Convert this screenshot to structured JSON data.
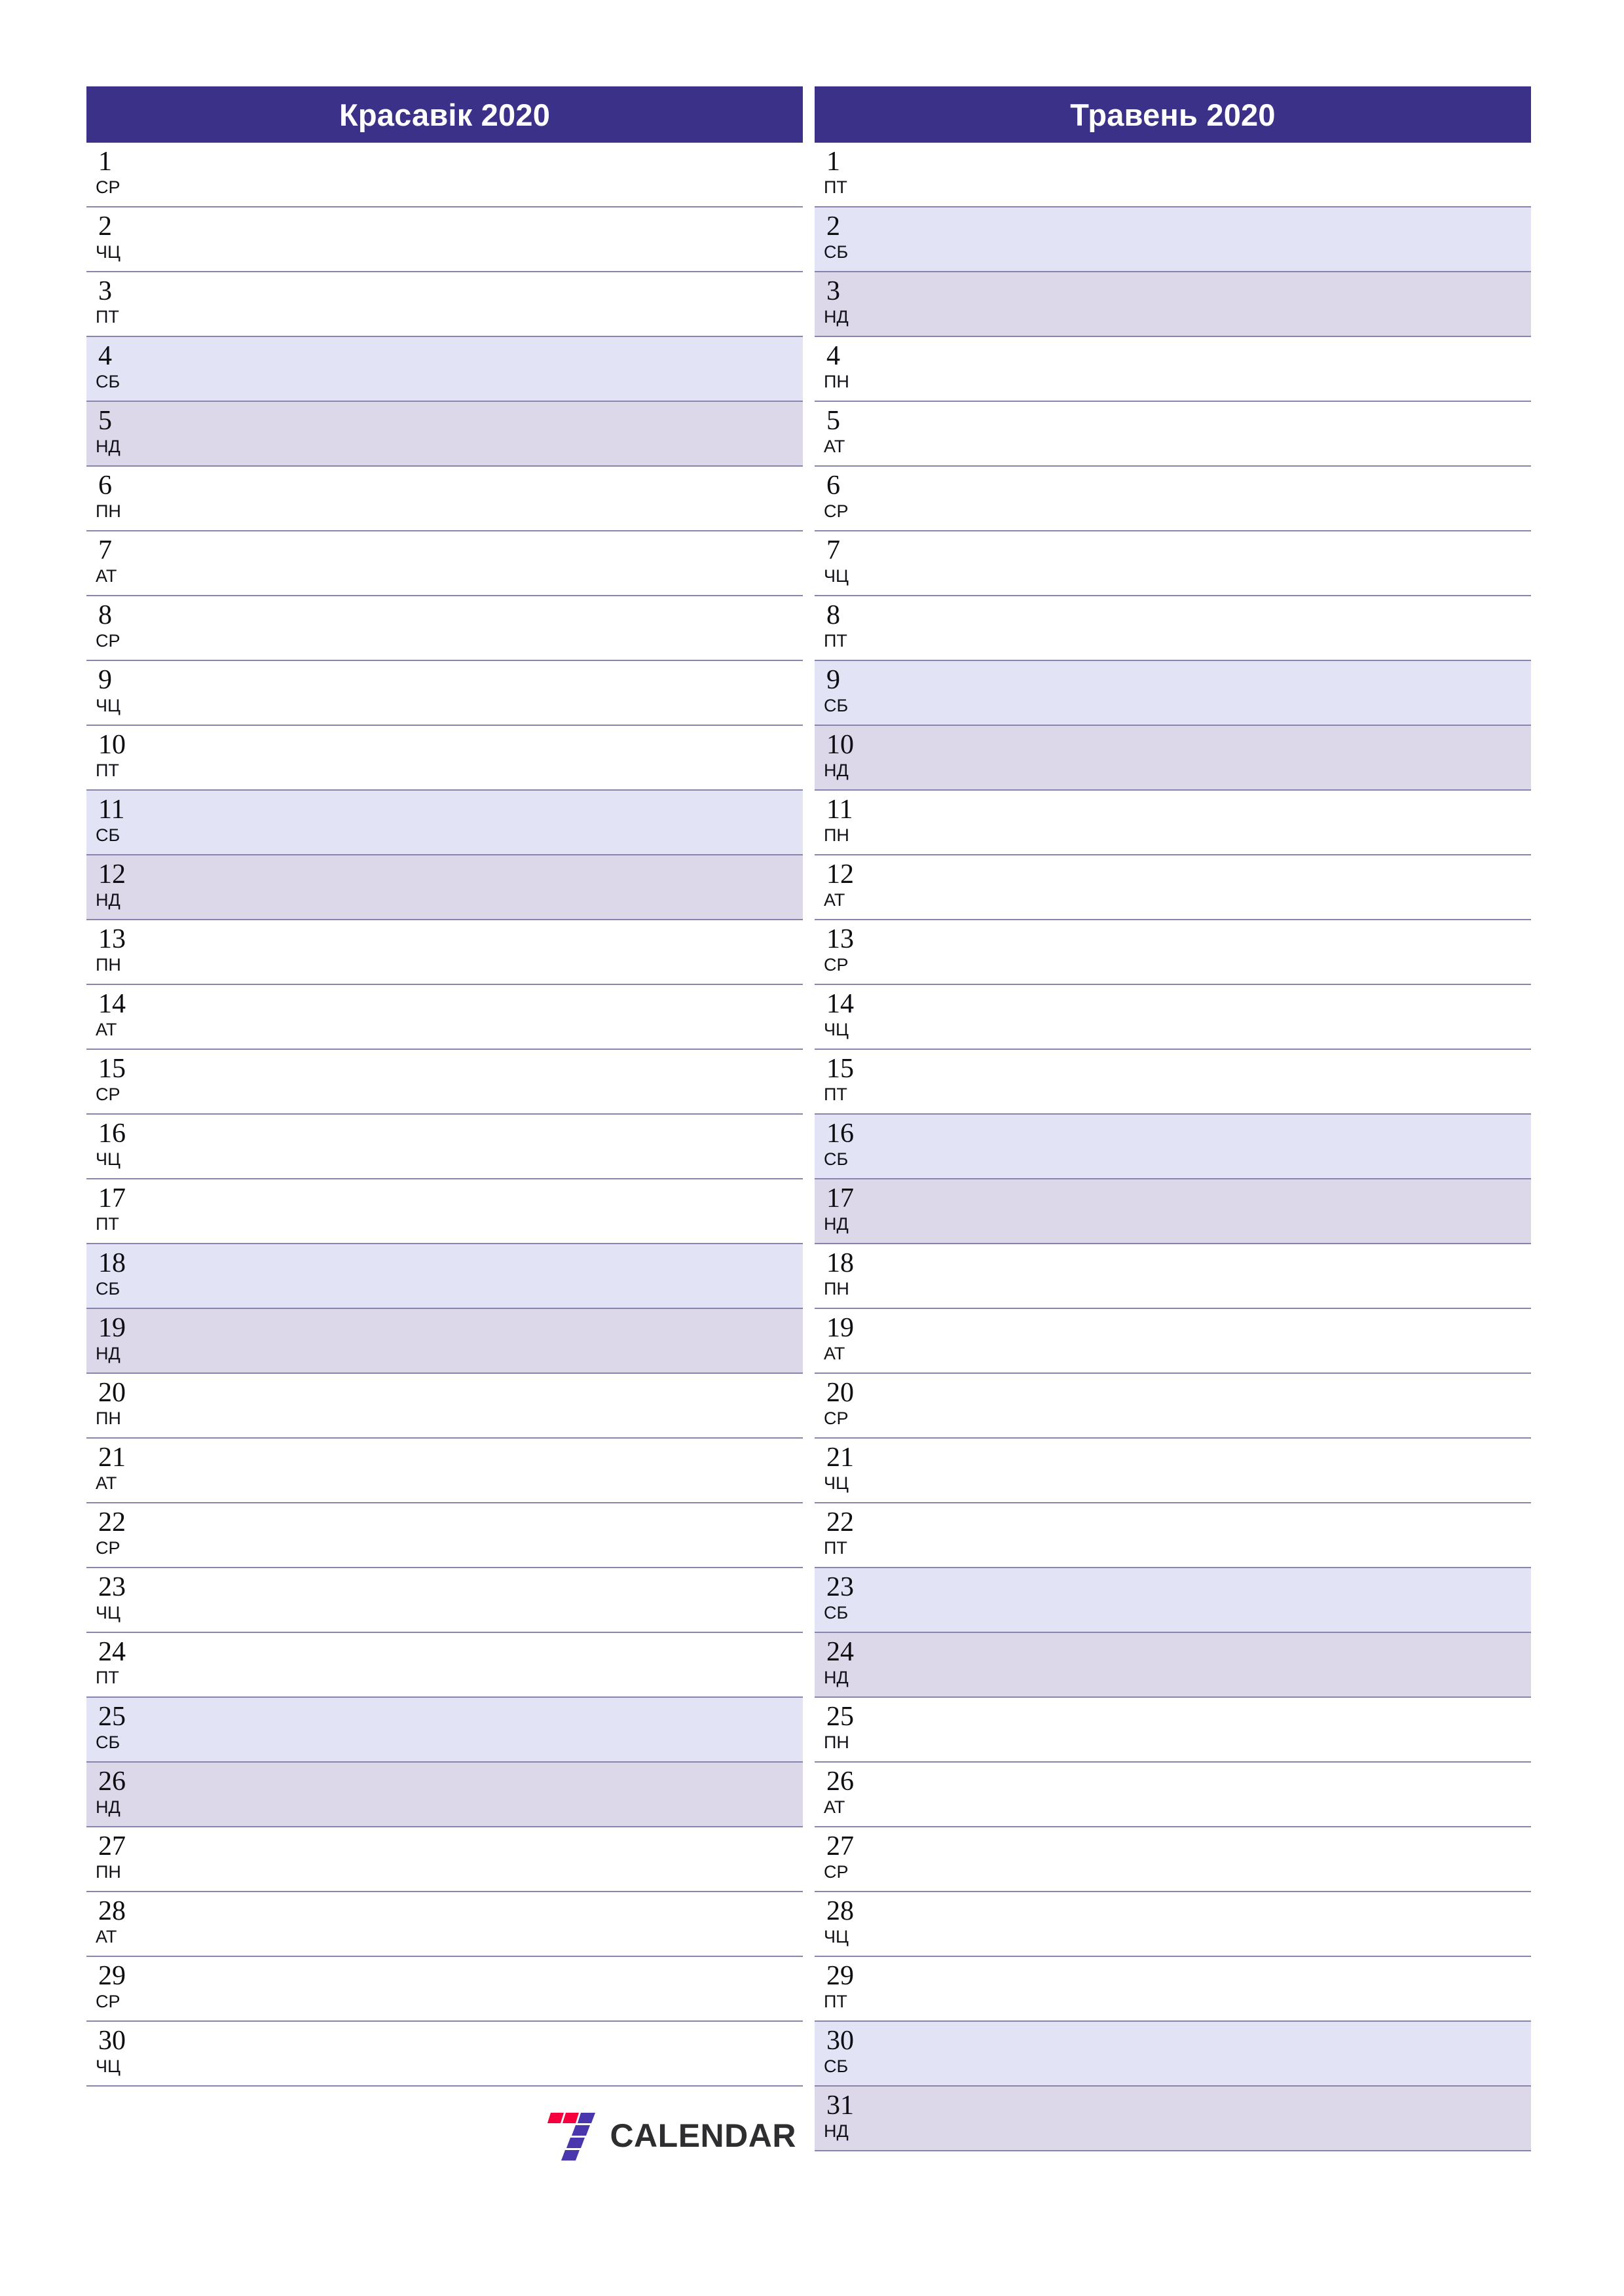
{
  "document": {
    "type": "two-month vertical planner",
    "year": "2020",
    "logo": {
      "mark_name": "seven-calendar-logo-mark",
      "wordmark": "CALENDAR",
      "colors": {
        "red": "#f5003c",
        "purple": "#4a36ad",
        "wordmark": "#2e2e30"
      }
    },
    "colors": {
      "header_background": "#3b3189",
      "header_text": "#ffffff",
      "saturday_row": "#e3e3f6",
      "sunday_row": "#dcd8ea",
      "row_border": "#8a83b0",
      "page_background": "#ffffff"
    }
  },
  "months": [
    {
      "title": "Красавік 2020",
      "days": [
        {
          "num": "1",
          "abbr": "СР",
          "kind": "weekday"
        },
        {
          "num": "2",
          "abbr": "ЧЦ",
          "kind": "weekday"
        },
        {
          "num": "3",
          "abbr": "ПТ",
          "kind": "weekday"
        },
        {
          "num": "4",
          "abbr": "СБ",
          "kind": "sat"
        },
        {
          "num": "5",
          "abbr": "НД",
          "kind": "sun"
        },
        {
          "num": "6",
          "abbr": "ПН",
          "kind": "weekday"
        },
        {
          "num": "7",
          "abbr": "АТ",
          "kind": "weekday"
        },
        {
          "num": "8",
          "abbr": "СР",
          "kind": "weekday"
        },
        {
          "num": "9",
          "abbr": "ЧЦ",
          "kind": "weekday"
        },
        {
          "num": "10",
          "abbr": "ПТ",
          "kind": "weekday"
        },
        {
          "num": "11",
          "abbr": "СБ",
          "kind": "sat"
        },
        {
          "num": "12",
          "abbr": "НД",
          "kind": "sun"
        },
        {
          "num": "13",
          "abbr": "ПН",
          "kind": "weekday"
        },
        {
          "num": "14",
          "abbr": "АТ",
          "kind": "weekday"
        },
        {
          "num": "15",
          "abbr": "СР",
          "kind": "weekday"
        },
        {
          "num": "16",
          "abbr": "ЧЦ",
          "kind": "weekday"
        },
        {
          "num": "17",
          "abbr": "ПТ",
          "kind": "weekday"
        },
        {
          "num": "18",
          "abbr": "СБ",
          "kind": "sat"
        },
        {
          "num": "19",
          "abbr": "НД",
          "kind": "sun"
        },
        {
          "num": "20",
          "abbr": "ПН",
          "kind": "weekday"
        },
        {
          "num": "21",
          "abbr": "АТ",
          "kind": "weekday"
        },
        {
          "num": "22",
          "abbr": "СР",
          "kind": "weekday"
        },
        {
          "num": "23",
          "abbr": "ЧЦ",
          "kind": "weekday"
        },
        {
          "num": "24",
          "abbr": "ПТ",
          "kind": "weekday"
        },
        {
          "num": "25",
          "abbr": "СБ",
          "kind": "sat"
        },
        {
          "num": "26",
          "abbr": "НД",
          "kind": "sun"
        },
        {
          "num": "27",
          "abbr": "ПН",
          "kind": "weekday"
        },
        {
          "num": "28",
          "abbr": "АТ",
          "kind": "weekday"
        },
        {
          "num": "29",
          "abbr": "СР",
          "kind": "weekday"
        },
        {
          "num": "30",
          "abbr": "ЧЦ",
          "kind": "weekday"
        }
      ]
    },
    {
      "title": "Травень 2020",
      "days": [
        {
          "num": "1",
          "abbr": "ПТ",
          "kind": "weekday"
        },
        {
          "num": "2",
          "abbr": "СБ",
          "kind": "sat"
        },
        {
          "num": "3",
          "abbr": "НД",
          "kind": "sun"
        },
        {
          "num": "4",
          "abbr": "ПН",
          "kind": "weekday"
        },
        {
          "num": "5",
          "abbr": "АТ",
          "kind": "weekday"
        },
        {
          "num": "6",
          "abbr": "СР",
          "kind": "weekday"
        },
        {
          "num": "7",
          "abbr": "ЧЦ",
          "kind": "weekday"
        },
        {
          "num": "8",
          "abbr": "ПТ",
          "kind": "weekday"
        },
        {
          "num": "9",
          "abbr": "СБ",
          "kind": "sat"
        },
        {
          "num": "10",
          "abbr": "НД",
          "kind": "sun"
        },
        {
          "num": "11",
          "abbr": "ПН",
          "kind": "weekday"
        },
        {
          "num": "12",
          "abbr": "АТ",
          "kind": "weekday"
        },
        {
          "num": "13",
          "abbr": "СР",
          "kind": "weekday"
        },
        {
          "num": "14",
          "abbr": "ЧЦ",
          "kind": "weekday"
        },
        {
          "num": "15",
          "abbr": "ПТ",
          "kind": "weekday"
        },
        {
          "num": "16",
          "abbr": "СБ",
          "kind": "sat"
        },
        {
          "num": "17",
          "abbr": "НД",
          "kind": "sun"
        },
        {
          "num": "18",
          "abbr": "ПН",
          "kind": "weekday"
        },
        {
          "num": "19",
          "abbr": "АТ",
          "kind": "weekday"
        },
        {
          "num": "20",
          "abbr": "СР",
          "kind": "weekday"
        },
        {
          "num": "21",
          "abbr": "ЧЦ",
          "kind": "weekday"
        },
        {
          "num": "22",
          "abbr": "ПТ",
          "kind": "weekday"
        },
        {
          "num": "23",
          "abbr": "СБ",
          "kind": "sat"
        },
        {
          "num": "24",
          "abbr": "НД",
          "kind": "sun"
        },
        {
          "num": "25",
          "abbr": "ПН",
          "kind": "weekday"
        },
        {
          "num": "26",
          "abbr": "АТ",
          "kind": "weekday"
        },
        {
          "num": "27",
          "abbr": "СР",
          "kind": "weekday"
        },
        {
          "num": "28",
          "abbr": "ЧЦ",
          "kind": "weekday"
        },
        {
          "num": "29",
          "abbr": "ПТ",
          "kind": "weekday"
        },
        {
          "num": "30",
          "abbr": "СБ",
          "kind": "sat"
        },
        {
          "num": "31",
          "abbr": "НД",
          "kind": "sun"
        }
      ]
    }
  ]
}
